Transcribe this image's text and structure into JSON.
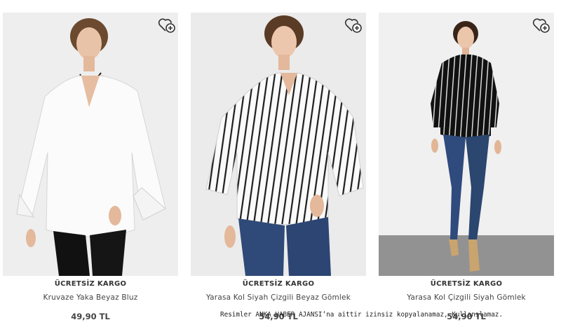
{
  "products": [
    {
      "badge": "ÜCRETSİZ KARGO",
      "name": "Kruvaze Yaka Beyaz Bluz",
      "price": "49,90 TL",
      "photo_alt": "model-white-blouse",
      "favorite_icon": "heart-plus-icon"
    },
    {
      "badge": "ÜCRETSİZ KARGO",
      "name": "Yarasa Kol Siyah Çizgili Beyaz Gömlek",
      "price": "54,90 TL",
      "photo_alt": "model-white-striped-shirt",
      "favorite_icon": "heart-plus-icon"
    },
    {
      "badge": "ÜCRETSİZ KARGO",
      "name": "Yarasa Kol Çizgili Siyah Gömlek",
      "price": "54,90 TL",
      "photo_alt": "model-black-striped-shirt",
      "favorite_icon": "heart-plus-icon"
    }
  ],
  "watermark": "Resimler ANKA HABER AJANSI’na aittir izinsiz kopyalanamaz, Kullanılamaz.",
  "colors": {
    "photo_bg": "#ececec",
    "text": "#444444",
    "denim": "#2f4a78"
  }
}
